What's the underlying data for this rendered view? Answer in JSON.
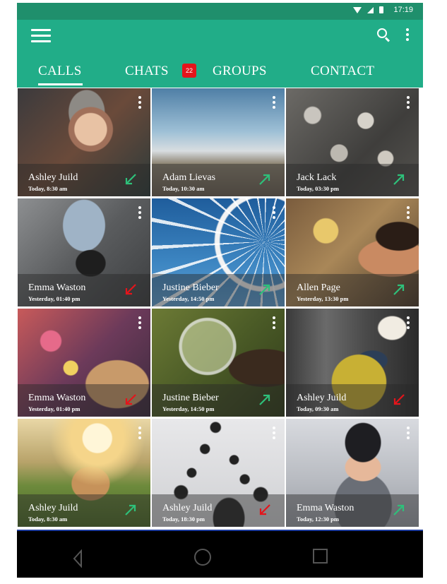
{
  "status_bar": {
    "time": "17:19"
  },
  "tabs": [
    {
      "label": "CALLS"
    },
    {
      "label": "CHATS"
    },
    {
      "label": "GROUPS"
    },
    {
      "label": "CONTACT"
    }
  ],
  "chats_badge": "22",
  "colors": {
    "app_bar": "#21ad88",
    "status_bar": "#1f8f6c",
    "incoming_arrow": "#2ec07a",
    "missed_arrow": "#e4141b"
  },
  "calls": [
    {
      "name": "Ashley Juild",
      "time": "Today, 8:30 am",
      "call_type": "incoming"
    },
    {
      "name": "Adam Lievas",
      "time": "Today, 10:30 am",
      "call_type": "outgoing"
    },
    {
      "name": "Jack Lack",
      "time": "Today, 03:30 pm",
      "call_type": "outgoing"
    },
    {
      "name": "Emma Waston",
      "time": "Yesterday, 01:40 pm",
      "call_type": "missed"
    },
    {
      "name": "Justine Bieber",
      "time": "Yesterday, 14:50 pm",
      "call_type": "outgoing"
    },
    {
      "name": "Allen Page",
      "time": "Yesterday, 13:30 pm",
      "call_type": "outgoing"
    },
    {
      "name": "Emma Waston",
      "time": "Yesterday, 01:40 pm",
      "call_type": "missed"
    },
    {
      "name": "Justine Bieber",
      "time": "Yesterday, 14:50 pm",
      "call_type": "outgoing"
    },
    {
      "name": "Ashley Juild",
      "time": "Today, 09:30 am",
      "call_type": "missed"
    },
    {
      "name": "Ashley Juild",
      "time": "Today, 8:30 am",
      "call_type": "outgoing"
    },
    {
      "name": "Ashley Juild",
      "time": "Today, 18:30 pm",
      "call_type": "missed"
    },
    {
      "name": "Emma Waston",
      "time": "Today, 12:30 pm",
      "call_type": "outgoing"
    }
  ]
}
